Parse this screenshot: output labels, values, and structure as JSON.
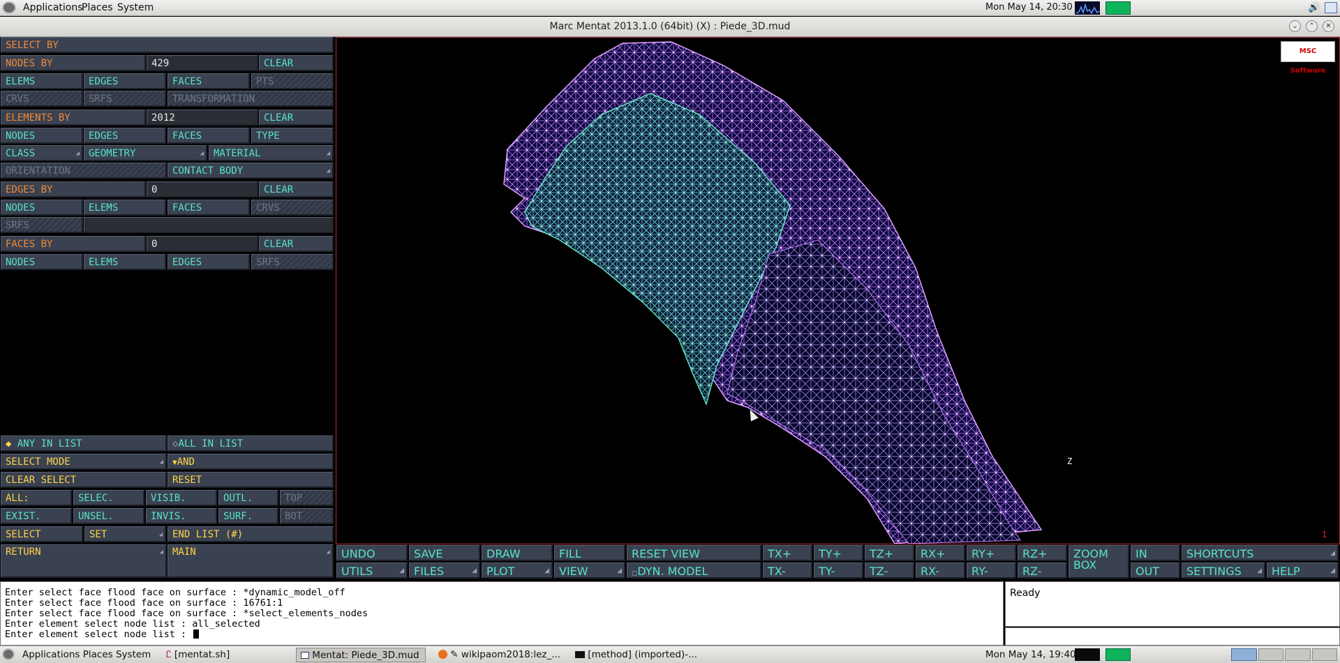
{
  "top_panel": {
    "menus": [
      "Applications",
      "Places",
      "System"
    ],
    "clock": "Mon May 14, 20:30"
  },
  "window": {
    "title": "Marc Mentat 2013.1.0 (64bit) (X) : Piede_3D.mud"
  },
  "menu": {
    "select_by": "SELECT BY",
    "nodes_by": {
      "label": "NODES BY",
      "value": "429",
      "clear": "CLEAR",
      "opts": [
        "ELEMS",
        "EDGES",
        "FACES",
        "PTS"
      ],
      "opts2": [
        "CRVS",
        "SRFS",
        "TRANSFORMATION"
      ]
    },
    "elements_by": {
      "label": "ELEMENTS BY",
      "value": "2012",
      "clear": "CLEAR",
      "opts": [
        "NODES",
        "EDGES",
        "FACES",
        "TYPE"
      ],
      "opts2": [
        "CLASS",
        "GEOMETRY",
        "MATERIAL"
      ],
      "orientation": "ORIENTATION",
      "contact_body": "CONTACT BODY"
    },
    "edges_by": {
      "label": "EDGES BY",
      "value": "0",
      "clear": "CLEAR",
      "opts": [
        "NODES",
        "ELEMS",
        "FACES",
        "CRVS"
      ],
      "srfs": "SRFS"
    },
    "faces_by": {
      "label": "FACES BY",
      "value": "0",
      "clear": "CLEAR",
      "opts": [
        "NODES",
        "ELEMS",
        "EDGES",
        "SRFS"
      ]
    },
    "any_in_list": "ANY IN LIST",
    "all_in_list": "ALL IN LIST",
    "select_mode": "SELECT MODE",
    "and": "AND",
    "clear_select": "CLEAR SELECT",
    "reset": "RESET",
    "row_all": [
      "ALL:",
      "SELEC.",
      "VISIB.",
      "OUTL.",
      "TOP"
    ],
    "row_exist": [
      "EXIST.",
      "UNSEL.",
      "INVIS.",
      "SURF.",
      "BOT"
    ],
    "select": "SELECT",
    "set": "SET",
    "end_list": "END LIST (#)",
    "return": "RETURN",
    "main": "MAIN"
  },
  "viewport": {
    "logo": "MSC Software",
    "frame_number": "1",
    "axis_label": "Z"
  },
  "toolbar": {
    "row1": [
      "UNDO",
      "SAVE",
      "DRAW",
      "FILL",
      "RESET VIEW",
      "TX+",
      "TY+",
      "TZ+",
      "RX+",
      "RY+",
      "RZ+",
      "ZOOM BOX",
      "IN",
      "SHORTCUTS"
    ],
    "row2": [
      "UTILS",
      "FILES",
      "PLOT",
      "VIEW",
      "DYN. MODEL",
      "TX-",
      "TY-",
      "TZ-",
      "RX-",
      "RY-",
      "RZ-",
      "OUT",
      "SETTINGS",
      "HELP"
    ]
  },
  "console": {
    "lines": [
      "Enter select face flood face on surface : *dynamic_model_off",
      "Enter select face flood face on surface :  16761:1",
      "Enter select face flood face on surface : *select_elements_nodes",
      "Enter element select node list : all_selected",
      "Enter element select node list : "
    ],
    "status": "Ready"
  },
  "taskbar": {
    "items": [
      "Applications Places System",
      "[mentat.sh]",
      "Mentat: Piede_3D.mud",
      "wikipaom2018:lez_...",
      "[method] (imported)-..."
    ],
    "clock": "Mon May 14, 19:40"
  },
  "colors": {
    "button_bg": "#3a4150",
    "label_yellow": "#ffd34a",
    "label_green": "#58e4c9",
    "label_orange": "#f08a3c",
    "mesh_purple": "#c77cff",
    "mesh_cyan": "#6ff0d8"
  }
}
